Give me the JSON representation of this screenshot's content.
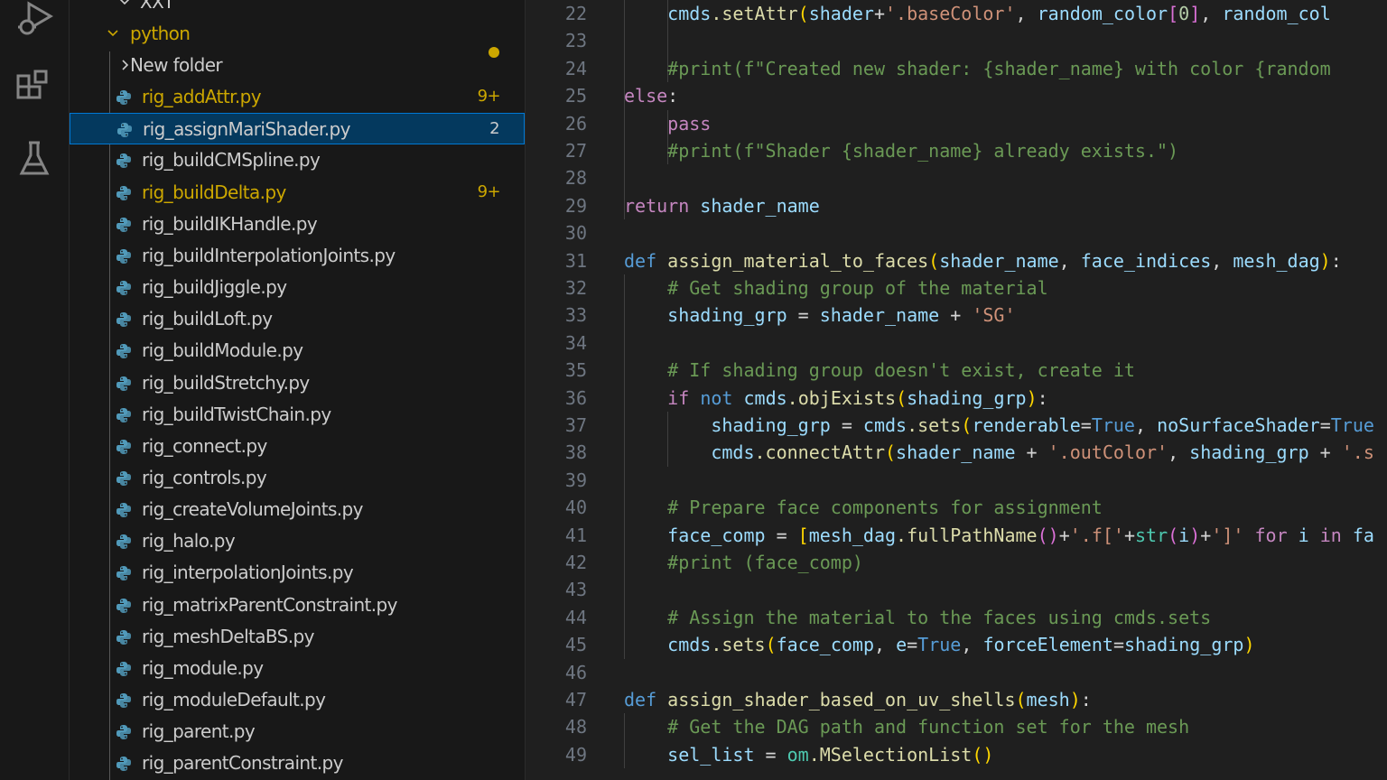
{
  "activity_bar": {
    "icons": [
      "run-debug-icon",
      "extensions-icon",
      "testing-icon"
    ]
  },
  "explorer": {
    "folder_partial": "XXT",
    "folder_name": "python",
    "items": [
      {
        "type": "folder",
        "label": "New folder",
        "status": "normal",
        "badge": ""
      },
      {
        "type": "file",
        "label": "rig_addAttr.py",
        "status": "modified",
        "badge": "9+"
      },
      {
        "type": "file",
        "label": "rig_assignMariShader.py",
        "status": "selected",
        "badge": "2"
      },
      {
        "type": "file",
        "label": "rig_buildCMSpline.py",
        "status": "normal",
        "badge": ""
      },
      {
        "type": "file",
        "label": "rig_buildDelta.py",
        "status": "modified",
        "badge": "9+"
      },
      {
        "type": "file",
        "label": "rig_buildIKHandle.py",
        "status": "normal",
        "badge": ""
      },
      {
        "type": "file",
        "label": "rig_buildInterpolationJoints.py",
        "status": "normal",
        "badge": ""
      },
      {
        "type": "file",
        "label": "rig_buildJiggle.py",
        "status": "normal",
        "badge": ""
      },
      {
        "type": "file",
        "label": "rig_buildLoft.py",
        "status": "normal",
        "badge": ""
      },
      {
        "type": "file",
        "label": "rig_buildModule.py",
        "status": "normal",
        "badge": ""
      },
      {
        "type": "file",
        "label": "rig_buildStretchy.py",
        "status": "normal",
        "badge": ""
      },
      {
        "type": "file",
        "label": "rig_buildTwistChain.py",
        "status": "normal",
        "badge": ""
      },
      {
        "type": "file",
        "label": "rig_connect.py",
        "status": "normal",
        "badge": ""
      },
      {
        "type": "file",
        "label": "rig_controls.py",
        "status": "normal",
        "badge": ""
      },
      {
        "type": "file",
        "label": "rig_createVolumeJoints.py",
        "status": "normal",
        "badge": ""
      },
      {
        "type": "file",
        "label": "rig_halo.py",
        "status": "normal",
        "badge": ""
      },
      {
        "type": "file",
        "label": "rig_interpolationJoints.py",
        "status": "normal",
        "badge": ""
      },
      {
        "type": "file",
        "label": "rig_matrixParentConstraint.py",
        "status": "normal",
        "badge": ""
      },
      {
        "type": "file",
        "label": "rig_meshDeltaBS.py",
        "status": "normal",
        "badge": ""
      },
      {
        "type": "file",
        "label": "rig_module.py",
        "status": "normal",
        "badge": ""
      },
      {
        "type": "file",
        "label": "rig_moduleDefault.py",
        "status": "normal",
        "badge": ""
      },
      {
        "type": "file",
        "label": "rig_parent.py",
        "status": "normal",
        "badge": ""
      },
      {
        "type": "file",
        "label": "rig_parentConstraint.py",
        "status": "normal",
        "badge": ""
      }
    ]
  },
  "editor": {
    "first_line_number": 22,
    "lines": [
      {
        "n": "22",
        "indent": 2,
        "t": [
          [
            "    ",
            ""
          ],
          [
            "cmds",
            "var"
          ],
          [
            ".setAttr",
            "fn"
          ],
          [
            "(",
            "br"
          ],
          [
            "shader",
            "var"
          ],
          [
            "+",
            "op"
          ],
          [
            "'.baseColor'",
            "str"
          ],
          [
            ", ",
            "op"
          ],
          [
            "random_color",
            "var"
          ],
          [
            "[",
            "br2"
          ],
          [
            "0",
            "num"
          ],
          [
            "]",
            "br2"
          ],
          [
            ", ",
            "op"
          ],
          [
            "random_col",
            "var"
          ]
        ]
      },
      {
        "n": "23",
        "indent": 2,
        "t": []
      },
      {
        "n": "24",
        "indent": 2,
        "t": [
          [
            "    ",
            ""
          ],
          [
            "#print(f\"Created new shader: {shader_name} with color {random",
            "com"
          ]
        ]
      },
      {
        "n": "25",
        "indent": 1,
        "t": [
          [
            "else",
            "ctl"
          ],
          [
            ":",
            "op"
          ]
        ]
      },
      {
        "n": "26",
        "indent": 2,
        "t": [
          [
            "    ",
            ""
          ],
          [
            "pass",
            "ctl"
          ]
        ]
      },
      {
        "n": "27",
        "indent": 2,
        "t": [
          [
            "    ",
            ""
          ],
          [
            "#print(f\"Shader {shader_name} already exists.\")",
            "com"
          ]
        ]
      },
      {
        "n": "28",
        "indent": 1,
        "t": []
      },
      {
        "n": "29",
        "indent": 1,
        "t": [
          [
            "return",
            "ctl"
          ],
          [
            " ",
            ""
          ],
          [
            "shader_name",
            "var"
          ]
        ]
      },
      {
        "n": "30",
        "indent": 0,
        "t": []
      },
      {
        "n": "31",
        "indent": 0,
        "t": [
          [
            "def",
            "kw"
          ],
          [
            " ",
            ""
          ],
          [
            "assign_material_to_faces",
            "fn"
          ],
          [
            "(",
            "br"
          ],
          [
            "shader_name",
            "var"
          ],
          [
            ", ",
            "op"
          ],
          [
            "face_indices",
            "var"
          ],
          [
            ", ",
            "op"
          ],
          [
            "mesh_dag",
            "var"
          ],
          [
            ")",
            "br"
          ],
          [
            ":",
            "op"
          ]
        ]
      },
      {
        "n": "32",
        "indent": 1,
        "t": [
          [
            "    ",
            ""
          ],
          [
            "# Get shading group of the material",
            "com"
          ]
        ]
      },
      {
        "n": "33",
        "indent": 1,
        "t": [
          [
            "    ",
            ""
          ],
          [
            "shading_grp",
            "var"
          ],
          [
            " = ",
            "op"
          ],
          [
            "shader_name",
            "var"
          ],
          [
            " + ",
            "op"
          ],
          [
            "'SG'",
            "str"
          ]
        ]
      },
      {
        "n": "34",
        "indent": 1,
        "t": []
      },
      {
        "n": "35",
        "indent": 1,
        "t": [
          [
            "    ",
            ""
          ],
          [
            "# If shading group doesn't exist, create it",
            "com"
          ]
        ]
      },
      {
        "n": "36",
        "indent": 1,
        "t": [
          [
            "    ",
            ""
          ],
          [
            "if",
            "ctl"
          ],
          [
            " ",
            ""
          ],
          [
            "not",
            "kw"
          ],
          [
            " ",
            ""
          ],
          [
            "cmds",
            "var"
          ],
          [
            ".objExists",
            "fn"
          ],
          [
            "(",
            "br"
          ],
          [
            "shading_grp",
            "var"
          ],
          [
            ")",
            "br"
          ],
          [
            ":",
            "op"
          ]
        ]
      },
      {
        "n": "37",
        "indent": 2,
        "t": [
          [
            "        ",
            ""
          ],
          [
            "shading_grp",
            "var"
          ],
          [
            " = ",
            "op"
          ],
          [
            "cmds",
            "var"
          ],
          [
            ".sets",
            "fn"
          ],
          [
            "(",
            "br"
          ],
          [
            "renderable",
            "var"
          ],
          [
            "=",
            "op"
          ],
          [
            "True",
            "kw"
          ],
          [
            ", ",
            "op"
          ],
          [
            "noSurfaceShader",
            "var"
          ],
          [
            "=",
            "op"
          ],
          [
            "True",
            "kw"
          ]
        ]
      },
      {
        "n": "38",
        "indent": 2,
        "t": [
          [
            "        ",
            ""
          ],
          [
            "cmds",
            "var"
          ],
          [
            ".connectAttr",
            "fn"
          ],
          [
            "(",
            "br"
          ],
          [
            "shader_name",
            "var"
          ],
          [
            " + ",
            "op"
          ],
          [
            "'.outColor'",
            "str"
          ],
          [
            ", ",
            "op"
          ],
          [
            "shading_grp",
            "var"
          ],
          [
            " + ",
            "op"
          ],
          [
            "'.s",
            "str"
          ]
        ]
      },
      {
        "n": "39",
        "indent": 1,
        "t": []
      },
      {
        "n": "40",
        "indent": 1,
        "t": [
          [
            "    ",
            ""
          ],
          [
            "# Prepare face components for assignment",
            "com"
          ]
        ]
      },
      {
        "n": "41",
        "indent": 1,
        "t": [
          [
            "    ",
            ""
          ],
          [
            "face_comp",
            "var"
          ],
          [
            " = ",
            "op"
          ],
          [
            "[",
            "br"
          ],
          [
            "mesh_dag",
            "var"
          ],
          [
            ".fullPathName",
            "fn"
          ],
          [
            "()",
            "br2"
          ],
          [
            "+",
            "op"
          ],
          [
            "'.f['",
            "str"
          ],
          [
            "+",
            "op"
          ],
          [
            "str",
            "cls"
          ],
          [
            "(",
            "br2"
          ],
          [
            "i",
            "var"
          ],
          [
            ")",
            "br2"
          ],
          [
            "+",
            "op"
          ],
          [
            "']'",
            "str"
          ],
          [
            " ",
            ""
          ],
          [
            "for",
            "ctl"
          ],
          [
            " ",
            ""
          ],
          [
            "i",
            "var"
          ],
          [
            " ",
            ""
          ],
          [
            "in",
            "ctl"
          ],
          [
            " ",
            ""
          ],
          [
            "fa",
            "var"
          ]
        ]
      },
      {
        "n": "42",
        "indent": 1,
        "t": [
          [
            "    ",
            ""
          ],
          [
            "#print (face_comp)",
            "com"
          ]
        ]
      },
      {
        "n": "43",
        "indent": 1,
        "t": []
      },
      {
        "n": "44",
        "indent": 1,
        "t": [
          [
            "    ",
            ""
          ],
          [
            "# Assign the material to the faces using cmds.sets",
            "com"
          ]
        ]
      },
      {
        "n": "45",
        "indent": 1,
        "t": [
          [
            "    ",
            ""
          ],
          [
            "cmds",
            "var"
          ],
          [
            ".sets",
            "fn"
          ],
          [
            "(",
            "br"
          ],
          [
            "face_comp",
            "var"
          ],
          [
            ", ",
            "op"
          ],
          [
            "e",
            "var"
          ],
          [
            "=",
            "op"
          ],
          [
            "True",
            "kw"
          ],
          [
            ", ",
            "op"
          ],
          [
            "forceElement",
            "var"
          ],
          [
            "=",
            "op"
          ],
          [
            "shading_grp",
            "var"
          ],
          [
            ")",
            "br"
          ]
        ]
      },
      {
        "n": "46",
        "indent": 0,
        "t": []
      },
      {
        "n": "47",
        "indent": 0,
        "t": [
          [
            "def",
            "kw"
          ],
          [
            " ",
            ""
          ],
          [
            "assign_shader_based_on_uv_shells",
            "fn"
          ],
          [
            "(",
            "br"
          ],
          [
            "mesh",
            "var"
          ],
          [
            ")",
            "br"
          ],
          [
            ":",
            "op"
          ]
        ]
      },
      {
        "n": "48",
        "indent": 1,
        "t": [
          [
            "    ",
            ""
          ],
          [
            "# Get the DAG path and function set for the mesh",
            "com"
          ]
        ]
      },
      {
        "n": "49",
        "indent": 1,
        "t": [
          [
            "    ",
            ""
          ],
          [
            "sel_list",
            "var"
          ],
          [
            " = ",
            "op"
          ],
          [
            "om",
            "cls"
          ],
          [
            ".MSelectionList",
            "fn"
          ],
          [
            "()",
            "br"
          ]
        ]
      }
    ]
  },
  "colors": {
    "modified": "#cca700",
    "selection": "#04395e",
    "selection_border": "#0078d4",
    "background": "#1f1f1f"
  }
}
